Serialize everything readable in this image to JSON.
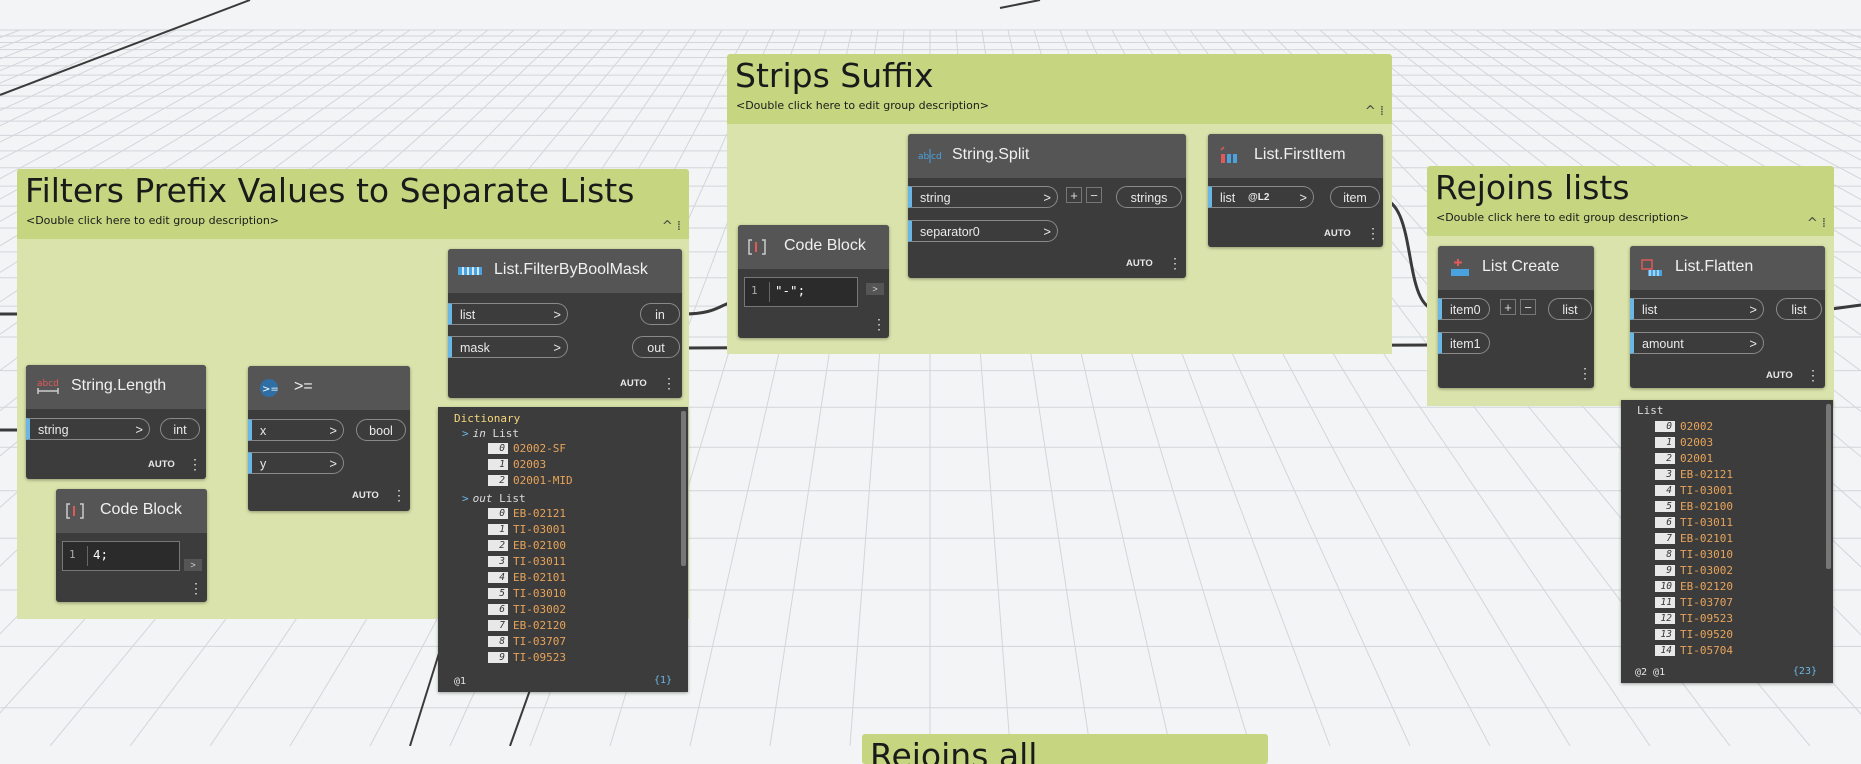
{
  "groups": {
    "filters": {
      "title": "Filters Prefix Values to Separate Lists",
      "description": "<Double click here to edit group description>",
      "collapse": "^ ⁞"
    },
    "strips": {
      "title": "Strips Suffix",
      "description": "<Double click here to edit group description>",
      "collapse": "^ ⁞"
    },
    "rejoins": {
      "title": "Rejoins lists",
      "description": "<Double click here to edit group description>",
      "collapse": "^ ⁞"
    },
    "bottom": {
      "title": "Rejoins all"
    }
  },
  "nodes": {
    "string_length": {
      "title": "String.Length",
      "in": [
        "string"
      ],
      "out": [
        "int"
      ],
      "lacing": "AUTO"
    },
    "code_block_4": {
      "title": "Code Block",
      "line": "1",
      "code": "4;"
    },
    "gte": {
      "title": ">=",
      "in": [
        "x",
        "y"
      ],
      "out": [
        "bool"
      ],
      "lacing": "AUTO"
    },
    "filter": {
      "title": "List.FilterByBoolMask",
      "in": [
        "list",
        "mask"
      ],
      "out": [
        "in",
        "out"
      ],
      "lacing": "AUTO"
    },
    "code_block_dash": {
      "title": "Code Block",
      "line": "1",
      "code": "\"-\";"
    },
    "string_split": {
      "title": "String.Split",
      "in": [
        "string",
        "separator0"
      ],
      "out": [
        "strings"
      ],
      "lacing": "AUTO"
    },
    "first_item": {
      "title": "List.FirstItem",
      "in": [
        "list"
      ],
      "level": "@L2",
      "out": [
        "item"
      ],
      "lacing": "AUTO"
    },
    "list_create": {
      "title": "List Create",
      "in": [
        "item0",
        "item1"
      ],
      "out": [
        "list"
      ]
    },
    "flatten": {
      "title": "List.Flatten",
      "in": [
        "list",
        "amount"
      ],
      "out": [
        "list"
      ],
      "lacing": "AUTO"
    }
  },
  "icons": {
    "plus": "+",
    "minus": "−",
    "chevron": ">",
    "more": "⋮"
  },
  "dict_preview": {
    "header": "Dictionary",
    "in_key": "in",
    "in_type": "List",
    "in_items": [
      [
        "0",
        "02002-SF"
      ],
      [
        "1",
        "02003"
      ],
      [
        "2",
        "02001-MID"
      ]
    ],
    "out_key": "out",
    "out_type": "List",
    "out_items": [
      [
        "0",
        "EB-02121"
      ],
      [
        "1",
        "TI-03001"
      ],
      [
        "2",
        "EB-02100"
      ],
      [
        "3",
        "TI-03011"
      ],
      [
        "4",
        "EB-02101"
      ],
      [
        "5",
        "TI-03010"
      ],
      [
        "6",
        "TI-03002"
      ],
      [
        "7",
        "EB-02120"
      ],
      [
        "8",
        "TI-03707"
      ],
      [
        "9",
        "TI-09523"
      ]
    ],
    "footer_left": "@1",
    "footer_right": "{1}"
  },
  "flatten_preview": {
    "header": "List",
    "items": [
      [
        "0",
        "02002"
      ],
      [
        "1",
        "02003"
      ],
      [
        "2",
        "02001"
      ],
      [
        "3",
        "EB-02121"
      ],
      [
        "4",
        "TI-03001"
      ],
      [
        "5",
        "EB-02100"
      ],
      [
        "6",
        "TI-03011"
      ],
      [
        "7",
        "EB-02101"
      ],
      [
        "8",
        "TI-03010"
      ],
      [
        "9",
        "TI-03002"
      ],
      [
        "10",
        "EB-02120"
      ],
      [
        "11",
        "TI-03707"
      ],
      [
        "12",
        "TI-09523"
      ],
      [
        "13",
        "TI-09520"
      ],
      [
        "14",
        "TI-05704"
      ]
    ],
    "footer_left": "@2 @1",
    "footer_right": "{23}"
  },
  "colors": {
    "group_header": "#c6d680",
    "group_body": "#d9e3ab",
    "node": "#3c3c3c",
    "port_accent": "#6ab7e6",
    "value": "#e8a45a"
  }
}
